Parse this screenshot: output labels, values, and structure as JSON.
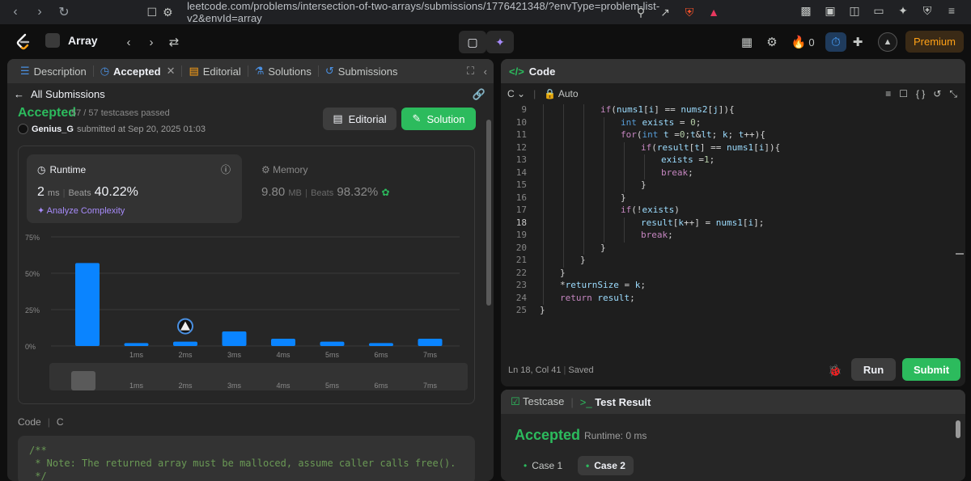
{
  "browser": {
    "url": "leetcode.com/problems/intersection-of-two-arrays/submissions/1776421348/?envType=problem-list-v2&envId=array",
    "badges": [
      "4",
      "1"
    ]
  },
  "topbar": {
    "problem_list": "Array",
    "points": "0",
    "premium": "Premium"
  },
  "left_tabs": [
    {
      "label": "Description"
    },
    {
      "label": "Accepted"
    },
    {
      "label": "Editorial"
    },
    {
      "label": "Solutions"
    },
    {
      "label": "Submissions"
    }
  ],
  "submission": {
    "back_label": "All Submissions",
    "status": "Accepted",
    "testcases": "57 / 57 testcases passed",
    "user": "Genius_G",
    "submitted_at": "submitted at Sep 20, 2025 01:03",
    "editorial_btn": "Editorial",
    "solution_btn": "Solution"
  },
  "runtime": {
    "title": "Runtime",
    "value": "2",
    "unit": "ms",
    "beats_label": "Beats",
    "beats": "40.22%",
    "analyze": "Analyze Complexity"
  },
  "memory": {
    "title": "Memory",
    "value": "9.80",
    "unit": "MB",
    "beats_label": "Beats",
    "beats": "98.32%"
  },
  "chart_data": {
    "type": "bar",
    "categories": [
      "",
      "1ms",
      "2ms",
      "3ms",
      "4ms",
      "5ms",
      "6ms",
      "7ms"
    ],
    "values": [
      57,
      2,
      3,
      10,
      5,
      3,
      2,
      5
    ],
    "ylim": [
      0,
      75
    ],
    "yticks": [
      "0%",
      "25%",
      "50%",
      "75%"
    ],
    "highlight": "2ms",
    "mini_labels": [
      "1ms",
      "2ms",
      "3ms",
      "4ms",
      "5ms",
      "6ms",
      "7ms"
    ]
  },
  "code_section": {
    "label": "Code",
    "lang": "C",
    "lines": [
      "/**",
      " * Note: The returned array must be malloced, assume caller calls free().",
      " */"
    ]
  },
  "editor": {
    "title": "Code",
    "lang": "C",
    "mode": "Auto",
    "status": "Ln 18, Col 41",
    "saved": "Saved",
    "run": "Run",
    "submit": "Submit",
    "lines": [
      {
        "n": "9",
        "i": 3,
        "t": "if(nums1[i] == nums2[j]){"
      },
      {
        "n": "10",
        "i": 4,
        "t": "int exists = 0;"
      },
      {
        "n": "11",
        "i": 4,
        "t": "for(int t =0;t< k; t++){"
      },
      {
        "n": "12",
        "i": 5,
        "t": "if(result[t] == nums1[i]){"
      },
      {
        "n": "13",
        "i": 6,
        "t": "exists =1;"
      },
      {
        "n": "14",
        "i": 6,
        "t": "break;"
      },
      {
        "n": "15",
        "i": 5,
        "t": "}"
      },
      {
        "n": "16",
        "i": 4,
        "t": "}"
      },
      {
        "n": "17",
        "i": 4,
        "t": "if(!exists)"
      },
      {
        "n": "18",
        "i": 5,
        "t": "result[k++] = nums1[i];"
      },
      {
        "n": "19",
        "i": 5,
        "t": "break;"
      },
      {
        "n": "20",
        "i": 3,
        "t": "}"
      },
      {
        "n": "21",
        "i": 2,
        "t": "}"
      },
      {
        "n": "22",
        "i": 1,
        "t": "}"
      },
      {
        "n": "23",
        "i": 1,
        "t": "*returnSize = k;"
      },
      {
        "n": "24",
        "i": 1,
        "t": "return result;"
      },
      {
        "n": "25",
        "i": 0,
        "t": "}"
      }
    ]
  },
  "result": {
    "testcase_tab": "Testcase",
    "result_tab": "Test Result",
    "status": "Accepted",
    "runtime": "Runtime: 0 ms",
    "cases": [
      "Case 1",
      "Case 2"
    ]
  }
}
